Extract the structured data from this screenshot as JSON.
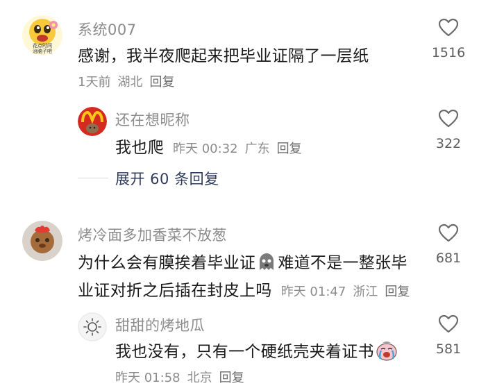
{
  "comments": [
    {
      "username": "系统007",
      "text": "感谢，我半夜爬起来把毕业证隔了一层纸",
      "time": "1天前",
      "location": "湖北",
      "reply_label": "回复",
      "likes": "1516",
      "avatar_lines": [
        "花点时间",
        "治脑子吧"
      ],
      "replies": [
        {
          "username": "还在想昵称",
          "text": "我也爬",
          "time": "昨天 00:32",
          "location": "广东",
          "reply_label": "回复",
          "likes": "322"
        }
      ],
      "expand_label": "展开 60 条回复"
    },
    {
      "username": "烤冷面多加香菜不放葱",
      "text_line1": "为什么会有膜挨着毕业证",
      "text_line1_after": "难道不是一整张毕",
      "text_line2": "业证对折之后插在封皮上吗",
      "time": "昨天 01:47",
      "location": "浙江",
      "reply_label": "回复",
      "likes": "681",
      "replies": [
        {
          "username": "甜甜的烤地瓜",
          "text": "我也没有，只有一个硬纸壳夹着证书",
          "time": "昨天 01:58",
          "location": "北京",
          "reply_label": "回复",
          "likes": "581"
        }
      ]
    }
  ],
  "icons": {
    "like": "heart-outline-icon",
    "emoji1": "ghost-face-emoji",
    "emoji2": "crying-face-emoji"
  }
}
